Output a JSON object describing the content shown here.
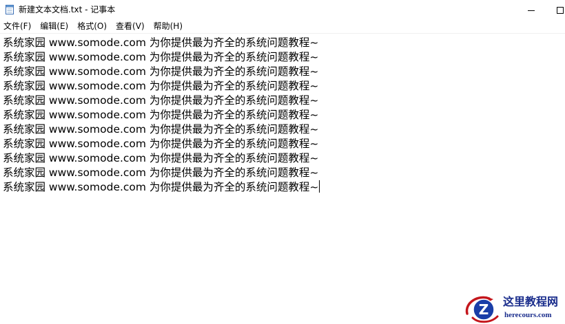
{
  "titlebar": {
    "title": "新建文本文档.txt - 记事本",
    "app_icon": "notepad-icon",
    "minimize_icon": "minimize-icon",
    "maximize_icon": "maximize-icon"
  },
  "menu": {
    "items": [
      {
        "label": "文件(F)"
      },
      {
        "label": "编辑(E)"
      },
      {
        "label": "格式(O)"
      },
      {
        "label": "查看(V)"
      },
      {
        "label": "帮助(H)"
      }
    ]
  },
  "editor": {
    "lines": [
      "系统家园 www.somode.com 为你提供最为齐全的系统问题教程~",
      "系统家园 www.somode.com 为你提供最为齐全的系统问题教程~",
      "系统家园 www.somode.com 为你提供最为齐全的系统问题教程~",
      "系统家园 www.somode.com 为你提供最为齐全的系统问题教程~",
      "系统家园 www.somode.com 为你提供最为齐全的系统问题教程~",
      "系统家园 www.somode.com 为你提供最为齐全的系统问题教程~",
      "系统家园 www.somode.com 为你提供最为齐全的系统问题教程~",
      "系统家园 www.somode.com 为你提供最为齐全的系统问题教程~",
      "系统家园 www.somode.com 为你提供最为齐全的系统问题教程~",
      "系统家园 www.somode.com 为你提供最为齐全的系统问题教程~",
      "系统家园 www.somode.com 为你提供最为齐全的系统问题教程~"
    ]
  },
  "watermark": {
    "title": "这里教程网",
    "url": "herecours.com",
    "logo_icon": "z-logo-icon"
  }
}
